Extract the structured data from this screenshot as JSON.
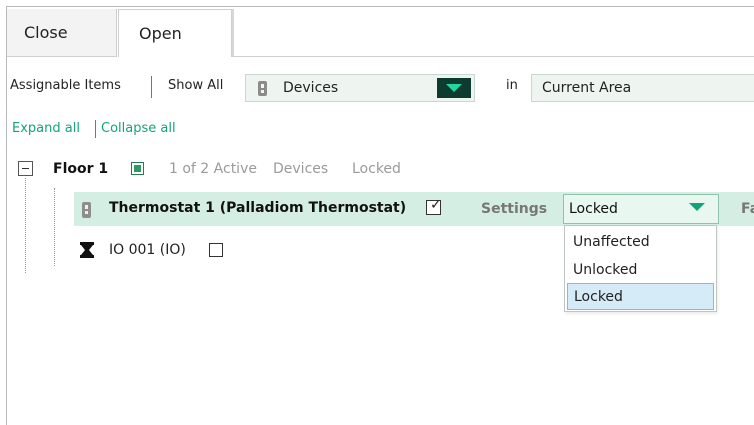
{
  "tabs": [
    {
      "label": "Close",
      "active": false
    },
    {
      "label": "Open",
      "active": true
    }
  ],
  "toolbar": {
    "assignable_items": "Assignable Items",
    "show_all": "Show All",
    "filter_combo": {
      "value": "Devices"
    },
    "in_label": "in",
    "area_combo": {
      "value": "Current Area"
    }
  },
  "links": {
    "expand_all": "Expand all",
    "collapse_all": "Collapse all"
  },
  "tree": {
    "floor": {
      "label": "Floor 1",
      "summary_count": "1 of 2 Active",
      "summary_kind": "Devices",
      "summary_state": "Locked"
    },
    "thermostat": {
      "label": "Thermostat 1 (Palladiom Thermostat)",
      "checked": true,
      "settings_label": "Settings",
      "setting_value": "Locked",
      "cut_off_text": "Fa"
    },
    "io": {
      "label": "IO 001 (IO)",
      "checked": false
    }
  },
  "dropdown": {
    "options": [
      "Unaffected",
      "Unlocked",
      "Locked"
    ],
    "selected": "Locked"
  },
  "colors": {
    "accent": "#14a37b",
    "dark_combo_button": "#0d3b2f",
    "row_highlight": "#d5eee3",
    "selection": "#d6ebf8"
  },
  "icons": {
    "device": "device-icon",
    "dropdown": "chevron-down-icon",
    "io": "io-icon",
    "check": "check-icon"
  }
}
